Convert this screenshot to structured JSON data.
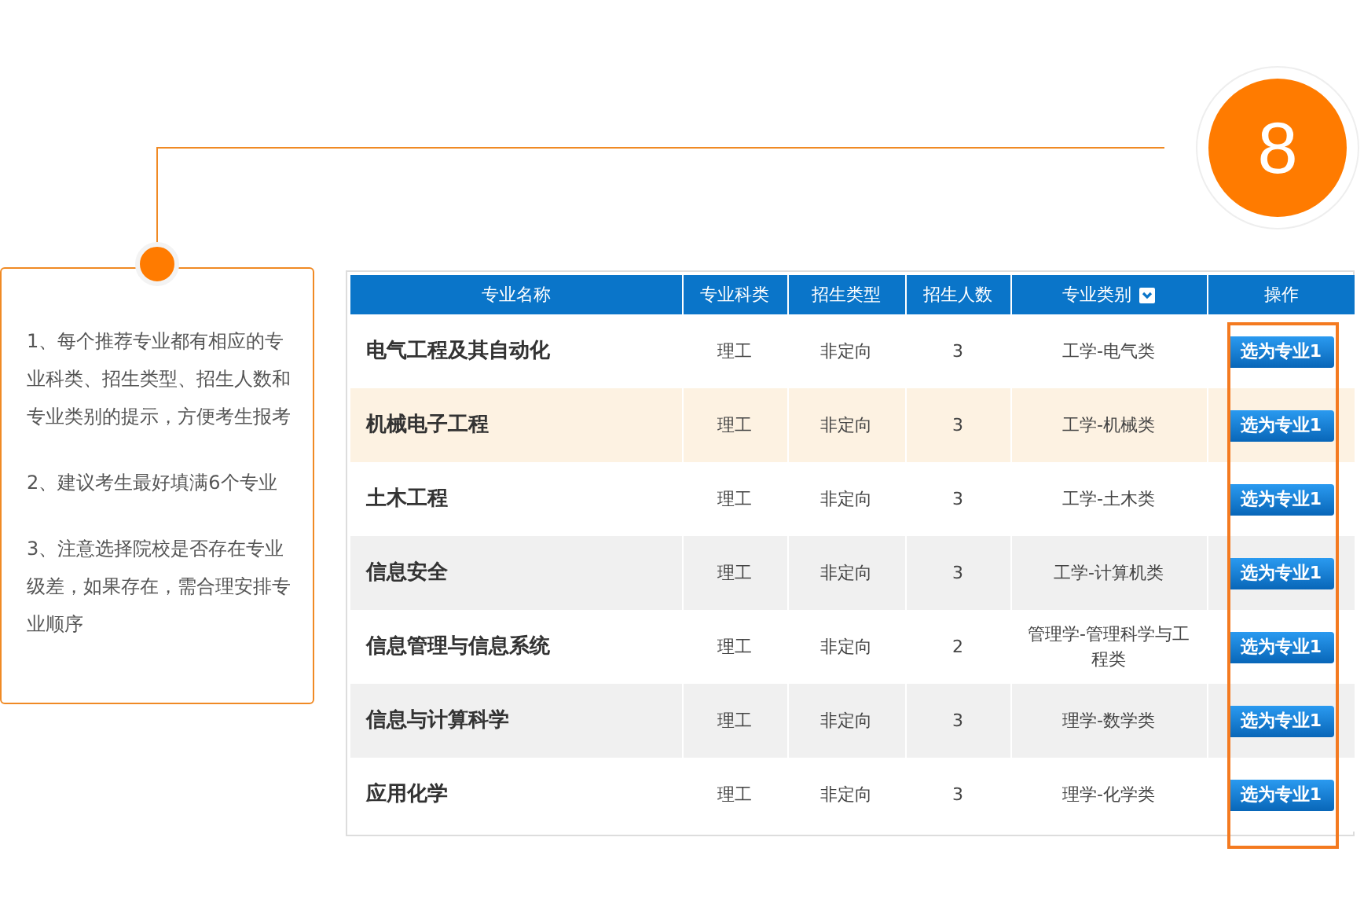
{
  "step_badge": "8",
  "tips": [
    "1、每个推荐专业都有相应的专业科类、招生类型、招生人数和专业类别的提示，方便考生报考",
    "2、建议考生最好填满6个专业",
    "3、注意选择院校是否存在专业级差，如果存在，需合理安排专业顺序"
  ],
  "table": {
    "columns": [
      {
        "label": "专业名称",
        "dropdown": false
      },
      {
        "label": "专业科类",
        "dropdown": false
      },
      {
        "label": "招生类型",
        "dropdown": false
      },
      {
        "label": "招生人数",
        "dropdown": false
      },
      {
        "label": "专业类别",
        "dropdown": true
      },
      {
        "label": "操作",
        "dropdown": false
      }
    ],
    "rows": [
      {
        "name": "电气工程及其自动化",
        "subject": "理工",
        "type": "非定向",
        "count": "3",
        "category": "工学-电气类",
        "action": "选为专业1",
        "highlighted": false
      },
      {
        "name": "机械电子工程",
        "subject": "理工",
        "type": "非定向",
        "count": "3",
        "category": "工学-机械类",
        "action": "选为专业1",
        "highlighted": true
      },
      {
        "name": "土木工程",
        "subject": "理工",
        "type": "非定向",
        "count": "3",
        "category": "工学-土木类",
        "action": "选为专业1",
        "highlighted": false
      },
      {
        "name": "信息安全",
        "subject": "理工",
        "type": "非定向",
        "count": "3",
        "category": "工学-计算机类",
        "action": "选为专业1",
        "highlighted": false
      },
      {
        "name": "信息管理与信息系统",
        "subject": "理工",
        "type": "非定向",
        "count": "2",
        "category": "管理学-管理科学与工程类",
        "action": "选为专业1",
        "highlighted": false
      },
      {
        "name": "信息与计算科学",
        "subject": "理工",
        "type": "非定向",
        "count": "3",
        "category": "理学-数学类",
        "action": "选为专业1",
        "highlighted": false
      },
      {
        "name": "应用化学",
        "subject": "理工",
        "type": "非定向",
        "count": "3",
        "category": "理学-化学类",
        "action": "选为专业1",
        "highlighted": false
      }
    ]
  }
}
